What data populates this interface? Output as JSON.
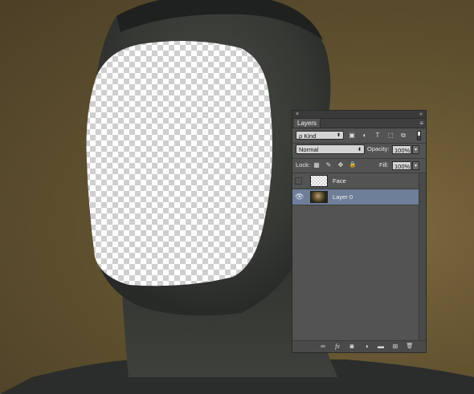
{
  "panel": {
    "close_glyph": "×",
    "collapse_glyph": "«",
    "tab_label": "Layers",
    "menu_glyph": "≡",
    "filter": {
      "kind_label": "ρ Kind",
      "kind_arrow": "⬍",
      "icons": [
        {
          "name": "pixel-filter-icon",
          "glyph": "▣"
        },
        {
          "name": "adjustment-filter-icon",
          "glyph": "◐"
        },
        {
          "name": "type-filter-icon",
          "glyph": "T"
        },
        {
          "name": "shape-filter-icon",
          "glyph": "⬚"
        },
        {
          "name": "smart-object-filter-icon",
          "glyph": "⧉"
        }
      ]
    },
    "blend_mode": "Normal",
    "blend_arrow": "⬍",
    "opacity_label": "Opacity:",
    "opacity_value": "100%",
    "lock_label": "Lock:",
    "lock_icons": [
      {
        "name": "lock-transparent-pixels-icon",
        "glyph": "▦"
      },
      {
        "name": "lock-image-pixels-icon",
        "glyph": "✎"
      },
      {
        "name": "lock-position-icon",
        "glyph": "✥"
      },
      {
        "name": "lock-all-icon",
        "glyph": "🔒"
      }
    ],
    "fill_label": "Fill:",
    "fill_value": "100%",
    "stepper_glyph": "▾",
    "layers": [
      {
        "name": "Face",
        "visible": false,
        "selected": false,
        "thumb": "checker"
      },
      {
        "name": "Layer 0",
        "visible": true,
        "selected": true,
        "thumb": "photo"
      }
    ],
    "eye_glyph": "👁",
    "bottom_icons": [
      {
        "name": "link-layers-icon",
        "glyph": "∞"
      },
      {
        "name": "layer-style-icon",
        "glyph": "fx"
      },
      {
        "name": "add-mask-icon",
        "glyph": "◙"
      },
      {
        "name": "adjustment-layer-icon",
        "glyph": "◑"
      },
      {
        "name": "new-group-icon",
        "glyph": "▬"
      },
      {
        "name": "new-layer-icon",
        "glyph": "⊞"
      },
      {
        "name": "delete-layer-icon",
        "glyph": "🗑"
      }
    ]
  },
  "colors": {
    "panel_bg": "#535353",
    "selection": "#6e7f9a",
    "background": "#6b5a35",
    "skin": "#3c3f3a"
  }
}
